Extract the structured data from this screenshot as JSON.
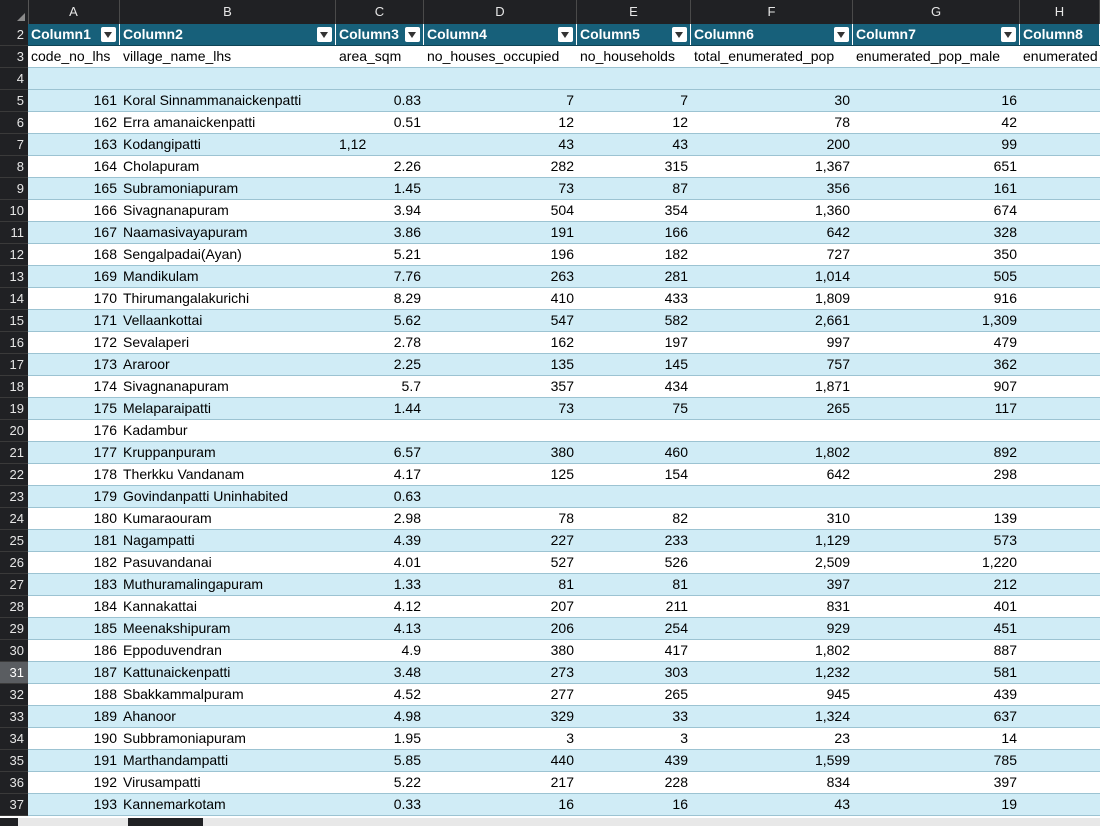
{
  "column_letters": [
    "A",
    "B",
    "C",
    "D",
    "E",
    "F",
    "G",
    "H"
  ],
  "table_headers": [
    "Column1",
    "Column2",
    "Column3",
    "Column4",
    "Column5",
    "Column6",
    "Column7",
    "Column8"
  ],
  "field_names": [
    "code_no_lhs",
    "village_name_lhs",
    "area_sqm",
    "no_houses_occupied",
    "no_households",
    "total_enumerated_pop",
    "enumerated_pop_male",
    "enumerated"
  ],
  "row_numbers": [
    "2",
    "3",
    "4",
    "5",
    "6",
    "7",
    "8",
    "9",
    "10",
    "11",
    "12",
    "13",
    "14",
    "15",
    "16",
    "17",
    "18",
    "19",
    "20",
    "21",
    "22",
    "23",
    "24",
    "25",
    "26",
    "27",
    "28",
    "29",
    "30",
    "31",
    "32",
    "33",
    "34",
    "35",
    "36",
    "37"
  ],
  "selected_row": "31",
  "rows": [
    [
      "161",
      "Koral Sinnammanaickenpatti",
      "0.83",
      "7",
      "7",
      "30",
      "16"
    ],
    [
      "162",
      "Erra amanaickenpatti",
      "0.51",
      "12",
      "12",
      "78",
      "42"
    ],
    [
      "163",
      "Kodangipatti",
      "1,12",
      "43",
      "43",
      "200",
      "99"
    ],
    [
      "164",
      "Cholapuram",
      "2.26",
      "282",
      "315",
      "1,367",
      "651"
    ],
    [
      "165",
      "Subramoniapuram",
      "1.45",
      "73",
      "87",
      "356",
      "161"
    ],
    [
      "166",
      "Sivagnanapuram",
      "3.94",
      "504",
      "354",
      "1,360",
      "674"
    ],
    [
      "167",
      "Naamasivayapuram",
      "3.86",
      "191",
      "166",
      "642",
      "328"
    ],
    [
      "168",
      "Sengalpadai(Ayan)",
      "5.21",
      "196",
      "182",
      "727",
      "350"
    ],
    [
      "169",
      "Mandikulam",
      "7.76",
      "263",
      "281",
      "1,014",
      "505"
    ],
    [
      "170",
      "Thirumangalakurichi",
      "8.29",
      "410",
      "433",
      "1,809",
      "916"
    ],
    [
      "171",
      "Vellaankottai",
      "5.62",
      "547",
      "582",
      "2,661",
      "1,309"
    ],
    [
      "172",
      "Sevalaperi",
      "2.78",
      "162",
      "197",
      "997",
      "479"
    ],
    [
      "173",
      "Araroor",
      "2.25",
      "135",
      "145",
      "757",
      "362"
    ],
    [
      "174",
      "Sivagnanapuram",
      "5.7",
      "357",
      "434",
      "1,871",
      "907"
    ],
    [
      "175",
      "Melaparaipatti",
      "1.44",
      "73",
      "75",
      "265",
      "117"
    ],
    [
      "176",
      "Kadambur",
      "",
      "",
      "",
      "",
      ""
    ],
    [
      "177",
      "Kruppanpuram",
      "6.57",
      "380",
      "460",
      "1,802",
      "892"
    ],
    [
      "178",
      "Therkku Vandanam",
      "4.17",
      "125",
      "154",
      "642",
      "298"
    ],
    [
      "179",
      "Govindanpatti Uninhabited",
      "0.63",
      "",
      "",
      "",
      ""
    ],
    [
      "180",
      "Kumaraouram",
      "2.98",
      "78",
      "82",
      "310",
      "139"
    ],
    [
      "181",
      "Nagampatti",
      "4.39",
      "227",
      "233",
      "1,129",
      "573"
    ],
    [
      "182",
      "Pasuvandanai",
      "4.01",
      "527",
      "526",
      "2,509",
      "1,220"
    ],
    [
      "183",
      "Muthuramalingapuram",
      "1.33",
      "81",
      "81",
      "397",
      "212"
    ],
    [
      "184",
      "Kannakattai",
      "4.12",
      "207",
      "211",
      "831",
      "401"
    ],
    [
      "185",
      "Meenakshipuram",
      "4.13",
      "206",
      "254",
      "929",
      "451"
    ],
    [
      "186",
      "Eppoduvendran",
      "4.9",
      "380",
      "417",
      "1,802",
      "887"
    ],
    [
      "187",
      "Kattunaickenpatti",
      "3.48",
      "273",
      "303",
      "1,232",
      "581"
    ],
    [
      "188",
      "Sbakkammalpuram",
      "4.52",
      "277",
      "265",
      "945",
      "439"
    ],
    [
      "189",
      "Ahanoor",
      "4.98",
      "329",
      "33",
      "1,324",
      "637"
    ],
    [
      "190",
      "Subbramoniapuram",
      "1.95",
      "3",
      "3",
      "23",
      "14"
    ],
    [
      "191",
      "Marthandampatti",
      "5.85",
      "440",
      "439",
      "1,599",
      "785"
    ],
    [
      "192",
      "Virusampatti",
      "5.22",
      "217",
      "228",
      "834",
      "397"
    ],
    [
      "193",
      "Kannemarkotam",
      "0.33",
      "16",
      "16",
      "43",
      "19"
    ]
  ],
  "colors": {
    "header_bg": "#17607a",
    "band_bg": "#d0ecf6",
    "frame_bg": "#202124"
  }
}
